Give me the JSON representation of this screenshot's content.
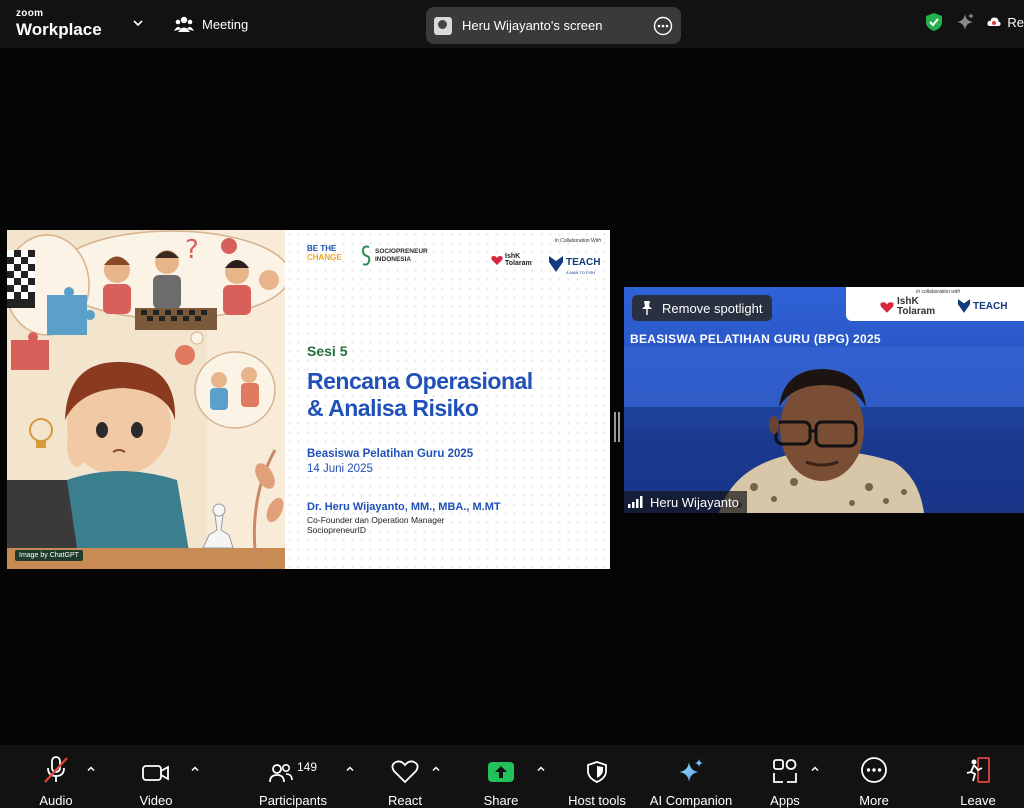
{
  "app": {
    "brand_top": "zoom",
    "brand_bottom": "Workplace"
  },
  "topbar": {
    "meeting_label": "Meeting",
    "screen_share_title": "Heru Wijayanto's screen",
    "record_label": "Re",
    "colors": {
      "shield": "#23b14d",
      "record_dot": "#e03a3a"
    }
  },
  "slide": {
    "image_credit": "Image by ChatGPT",
    "logos": {
      "be_the": "BE THE",
      "change": "CHANGE",
      "sociopreneur": "SOCIOPRENEUR",
      "indonesia": "INDONESIA",
      "collab": "In Collaboration With",
      "ishk": "IshK",
      "tolaram": "Tolaram",
      "teach": "TEACH",
      "teach_sub": "A MAN TO FISH"
    },
    "session": "Sesi 5",
    "title_line1": "Rencana Operasional",
    "title_line2": "& Analisa Risiko",
    "program": "Beasiswa Pelatihan Guru 2025",
    "date": "14 Juni 2025",
    "presenter": "Dr. Heru Wijayanto, MM., MBA., M.MT",
    "role_line1": "Co-Founder dan Operation Manager",
    "role_line2": "SociopreneurID",
    "colors": {
      "green": "#23703a",
      "blue": "#2151b8"
    }
  },
  "video": {
    "spotlight_label": "Remove spotlight",
    "participant_name": "Heru Wijayanto",
    "banner_text": "BEASISWA PELATIHAN GURU (BPG) 2025",
    "collab": "In collaboration with",
    "ishk": "IshK",
    "tolaram": "Tolaram",
    "teach": "TEACH"
  },
  "toolbar": {
    "audio": "Audio",
    "video": "Video",
    "participants": "Participants",
    "participants_count": "149",
    "react": "React",
    "share": "Share",
    "host_tools": "Host tools",
    "ai_companion": "AI Companion",
    "apps": "Apps",
    "more": "More",
    "leave": "Leave",
    "colors": {
      "share": "#23c15a",
      "muted": "#e0463c",
      "leave": "#e0463c"
    }
  }
}
